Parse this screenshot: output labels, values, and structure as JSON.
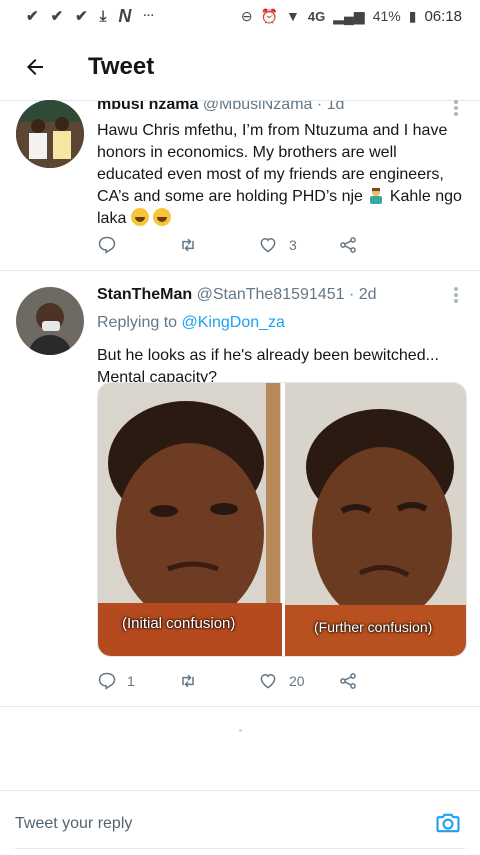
{
  "status_bar": {
    "signal_label": "4G",
    "battery_percent": "41%",
    "time": "06:18"
  },
  "header": {
    "title": "Tweet"
  },
  "tweets": [
    {
      "display_name": "mbusi nzama",
      "handle": "@MbusiNzama",
      "time": "1d",
      "text_line_1": "Hawu Chris mfethu, I’m from Ntuzuma and I have honors in economics. My brothers are well educated even most of my friends are engineers, CA’s and some are holding PHD’s nje",
      "text_line_2": "Kahle ngo laka",
      "likes": "3"
    },
    {
      "display_name": "StanTheMan",
      "handle": "@StanThe81591451",
      "time": "2d",
      "replying_prefix": "Replying to",
      "replying_to": "@KingDon_za",
      "text": "But he looks as if he's already been bewitched... Mental capacity?",
      "meme_caption_left": "(Initial confusion)",
      "meme_caption_right": "(Further confusion)",
      "replies": "1",
      "likes": "20"
    }
  ],
  "composer": {
    "placeholder": "Tweet your reply"
  },
  "colors": {
    "accent": "#1da1f2",
    "secondary_text": "#657786",
    "divider": "#e1e8ed"
  }
}
